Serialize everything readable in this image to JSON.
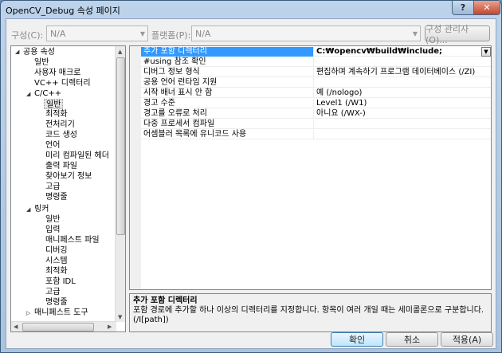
{
  "window": {
    "title": "OpenCV_Debug 속성 페이지",
    "help_label": "?",
    "close_label": "✕"
  },
  "toolbar": {
    "config_label": "구성(C):",
    "config_value": "N/A",
    "platform_label": "플랫폼(P):",
    "platform_value": "N/A",
    "config_manager_label": "구성 관리자(O)..."
  },
  "tree": {
    "root": "공용 속성",
    "common_items": [
      "일반",
      "사용자 매크로",
      "VC++ 디렉터리"
    ],
    "cpp_label": "C/C++",
    "cpp_items": [
      "일반",
      "최적화",
      "전처리기",
      "코드 생성",
      "언어",
      "미리 컴파일된 헤더",
      "출력 파일",
      "찾아보기 정보",
      "고급",
      "명령줄"
    ],
    "linker_label": "링커",
    "linker_items": [
      "일반",
      "입력",
      "매니페스트 파일",
      "디버깅",
      "시스템",
      "최적화",
      "포함 IDL",
      "고급",
      "명령줄"
    ],
    "partial_item": "매니페스트 도구"
  },
  "grid": {
    "rows": [
      {
        "name": "추가 포함 디렉터리",
        "value": "C:₩opencv₩build₩include;"
      },
      {
        "name": "#using 참조 확인",
        "value": ""
      },
      {
        "name": "디버그 정보 형식",
        "value": "편집하며 계속하기 프로그램 데이터베이스 (/ZI)"
      },
      {
        "name": "공용 언어 런타임 지원",
        "value": ""
      },
      {
        "name": "시작 배너 표시 안 함",
        "value": "예 (/nologo)"
      },
      {
        "name": "경고 수준",
        "value": "Level1 (/W1)"
      },
      {
        "name": "경고를 오류로 처리",
        "value": "아니요 (/WX-)"
      },
      {
        "name": "다중 프로세서 컴파일",
        "value": ""
      },
      {
        "name": "어셈블러 목록에 유니코드 사용",
        "value": ""
      }
    ]
  },
  "description": {
    "title": "추가 포함 디렉터리",
    "text": "포함 경로에 추가할 하나 이상의 디렉터리를 지정합니다. 항목이 여러 개일 때는 세미콜론으로 구분합니다. (/I[path])"
  },
  "buttons": {
    "ok": "확인",
    "cancel": "취소",
    "apply": "적용(A)"
  }
}
